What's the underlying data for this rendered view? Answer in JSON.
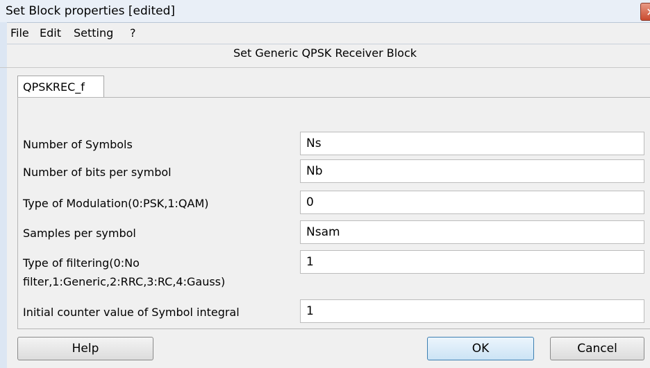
{
  "window": {
    "title": "Set Block properties [edited]",
    "close_symbol": "✕"
  },
  "menu": [
    "File",
    "Edit",
    "Setting",
    "?"
  ],
  "dialog": {
    "heading": "Set Generic QPSK Receiver Block"
  },
  "tab": {
    "label": "QPSKREC_f"
  },
  "params": [
    {
      "label": "Number of Symbols",
      "value": "Ns"
    },
    {
      "label": "Number of bits per symbol",
      "value": "Nb"
    },
    {
      "label": "Type of Modulation(0:PSK,1:QAM)",
      "value": "0"
    },
    {
      "label": "Samples per symbol",
      "value": "Nsam"
    },
    {
      "label_line1": "Type of filtering(0:No",
      "label_line2": "filter,1:Generic,2:RRC,3:RC,4:Gauss)",
      "value": "1"
    },
    {
      "label": "Initial counter value of Symbol integral",
      "value": "1"
    }
  ],
  "buttons": {
    "help": "Help",
    "ok": "OK",
    "cancel": "Cancel"
  },
  "colors": {
    "title_bar": "#e9eff7",
    "close_button": "#c94a2f",
    "window_bg": "#f0f0f0",
    "ok_border": "#3c7fb1"
  }
}
